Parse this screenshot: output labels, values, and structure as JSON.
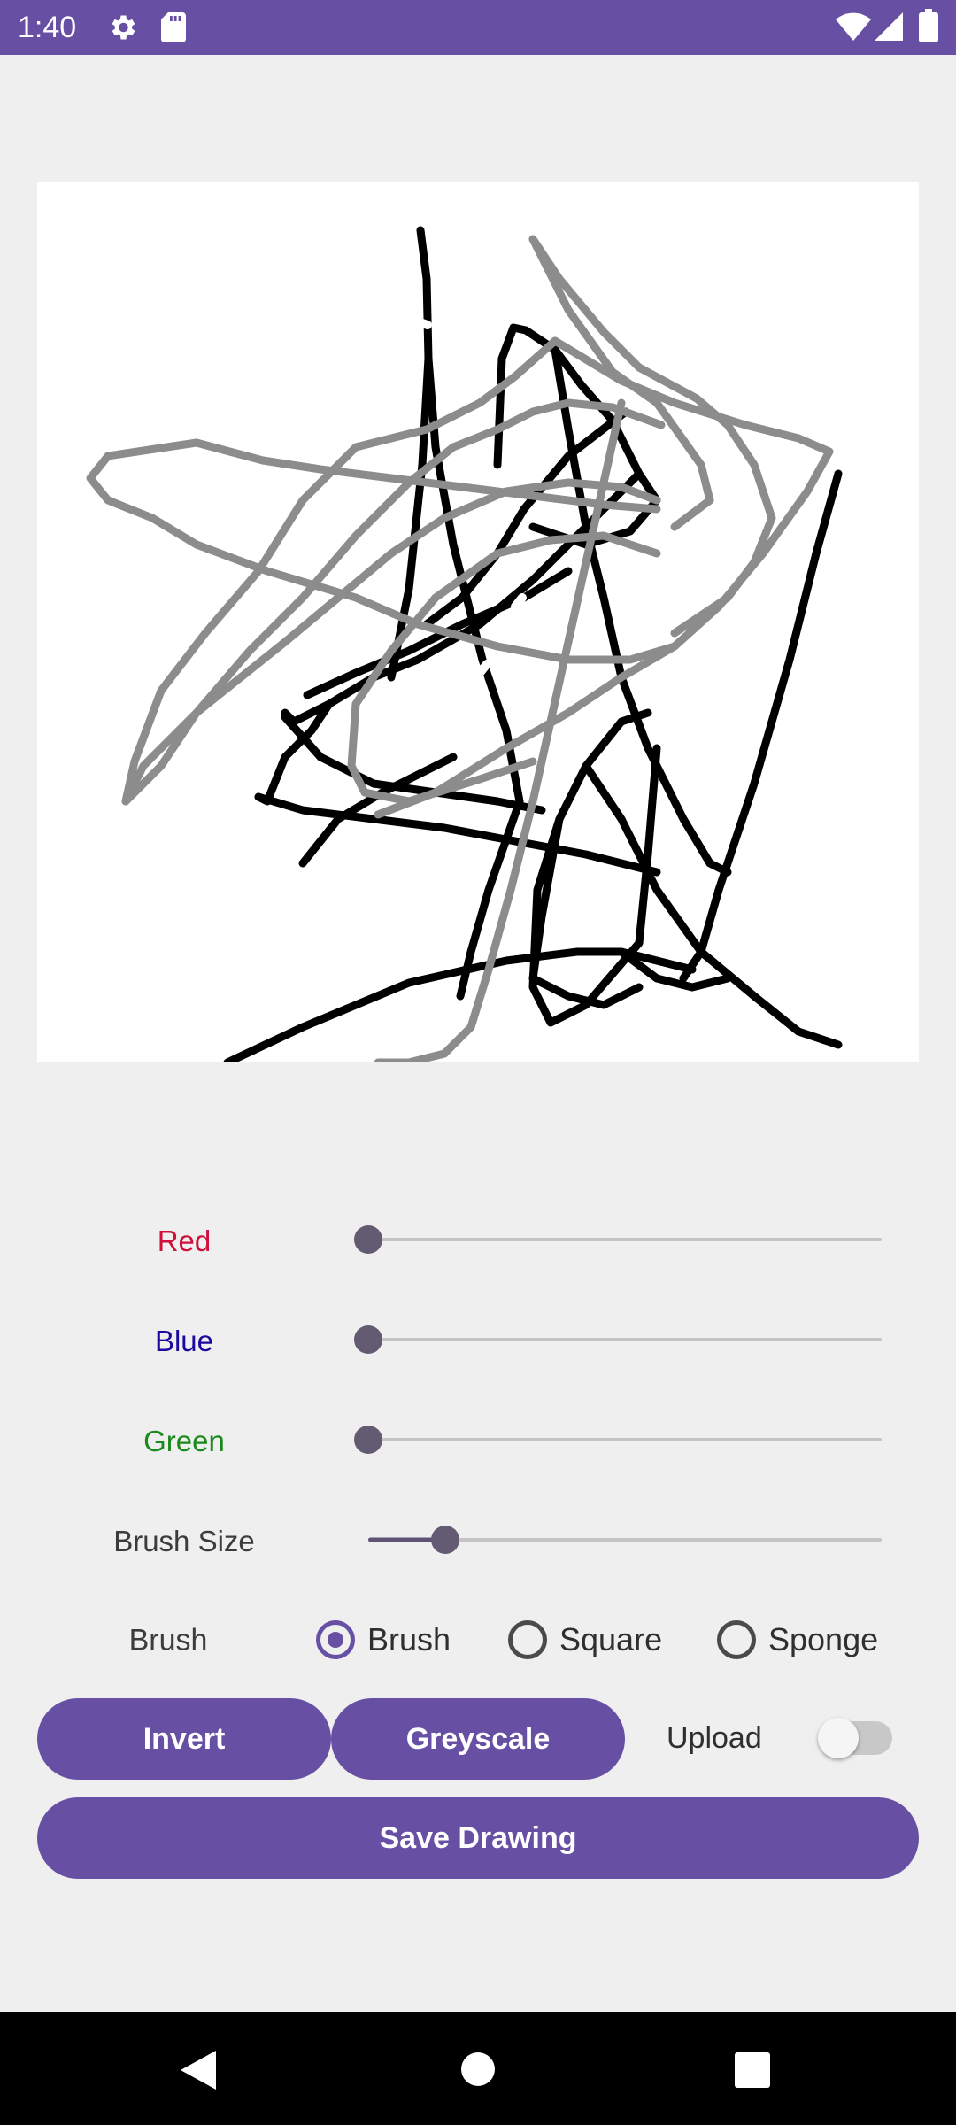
{
  "status_bar": {
    "time": "1:40",
    "background": "#6750a4",
    "icons": [
      "gear-icon",
      "sd-card-icon",
      "wifi-icon",
      "signal-icon",
      "battery-icon"
    ]
  },
  "drawing_canvas": {
    "background": "#ffffff",
    "stroke_colors": [
      "#000000",
      "#8c8c8c"
    ]
  },
  "sliders": {
    "red": {
      "label": "Red",
      "label_color": "#d0103a",
      "value": 0
    },
    "blue": {
      "label": "Blue",
      "label_color": "#1a0aa0",
      "value": 0
    },
    "green": {
      "label": "Green",
      "label_color": "#1a8a1a",
      "value": 0
    },
    "brush_size": {
      "label": "Brush Size",
      "label_color": "#3c3c3c",
      "value_fraction": 0.15
    }
  },
  "brush_type": {
    "label": "Brush",
    "options": [
      {
        "label": "Brush",
        "selected": true
      },
      {
        "label": "Square",
        "selected": false
      },
      {
        "label": "Sponge",
        "selected": false
      }
    ]
  },
  "actions": {
    "invert_label": "Invert",
    "greyscale_label": "Greyscale",
    "upload_label": "Upload",
    "upload_enabled": false,
    "save_label": "Save Drawing",
    "accent": "#6750a4"
  },
  "nav_bar": {
    "icons": [
      "back-icon",
      "home-icon",
      "recents-icon"
    ]
  }
}
